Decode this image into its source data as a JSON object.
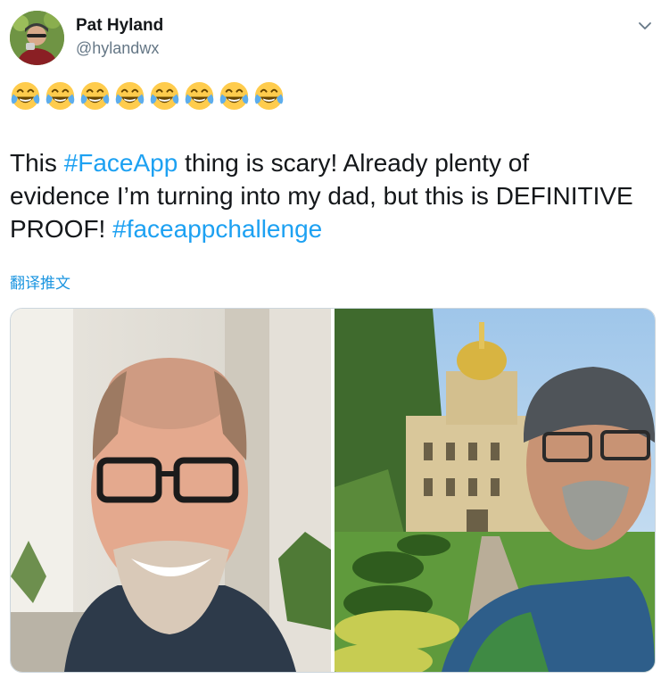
{
  "tweet": {
    "author_name": "Pat Hyland",
    "author_handle": "@hylandwx",
    "emoji_line": [
      "😂",
      "😂",
      "😂",
      "😂",
      "😂",
      "😂",
      "😂",
      "😂"
    ],
    "text_segments": [
      {
        "type": "text",
        "value": "This "
      },
      {
        "type": "hashtag",
        "value": "#FaceApp"
      },
      {
        "type": "text",
        "value": " thing is scary! Already plenty of evidence I’m turning into my dad, but this is DEFINITIVE PROOF! "
      },
      {
        "type": "hashtag",
        "value": "#faceappchallenge"
      }
    ],
    "translate_label": "翻译推文",
    "images": [
      "photo-left-man-smiling-glasses",
      "photo-right-man-campus-cap"
    ]
  },
  "colors": {
    "link": "#1da1f2",
    "translate_link": "#1b95e0",
    "secondary_text": "#657786",
    "border": "#ccd6dd"
  },
  "icons": {
    "menu": "chevron-down-icon",
    "emoji": "face-with-tears-of-joy-icon"
  }
}
